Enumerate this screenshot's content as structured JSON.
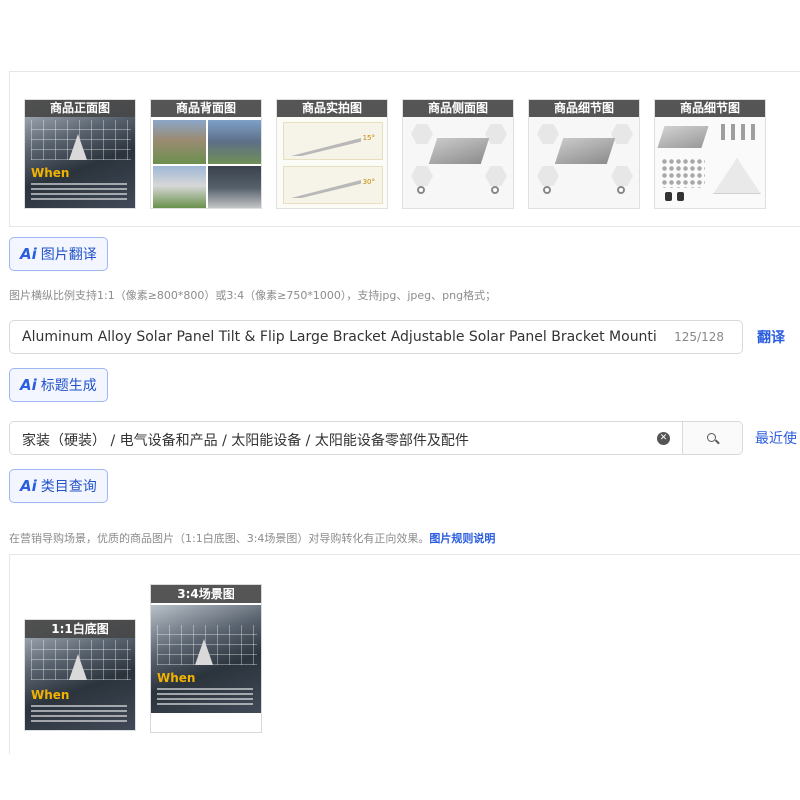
{
  "images": {
    "thumbnails": [
      {
        "caption": "商品正面图",
        "kind": "solar"
      },
      {
        "caption": "商品背面图",
        "kind": "house"
      },
      {
        "caption": "商品实拍图",
        "kind": "real"
      },
      {
        "caption": "商品侧面图",
        "kind": "parts"
      },
      {
        "caption": "商品细节图",
        "kind": "parts"
      },
      {
        "caption": "商品细节图",
        "kind": "kit"
      }
    ],
    "solar_overlay_text": "When",
    "real_labels": [
      "15°",
      "30°"
    ],
    "ai_translate_label": "图片翻译",
    "hint": "图片横纵比例支持1:1（像素≥800*800）或3:4（像素≥750*1000），支持jpg、jpeg、png格式；"
  },
  "title": {
    "value": "Aluminum Alloy  Solar Panel Tilt & Flip Large Bracket Adjustable Solar Panel Bracket Mounti",
    "count": "125/128",
    "translate_label": "翻译",
    "ai_generate_label": "标题生成"
  },
  "category": {
    "value": "家装（硬装） / 电气设备和产品 / 太阳能设备 / 太阳能设备零部件及配件",
    "recent_label": "最近使",
    "ai_query_label": "类目查询"
  },
  "marketing": {
    "hint_text": "在营销导购场景，优质的商品图片（1:1白底图、3:4场景图）对导购转化有正向效果。",
    "hint_link": "图片规则说明",
    "square_caption": "1:1白底图",
    "tall_caption": "3:4场景图"
  },
  "ai_icon_text": "Ai",
  "clear_icon_glyph": "✕"
}
